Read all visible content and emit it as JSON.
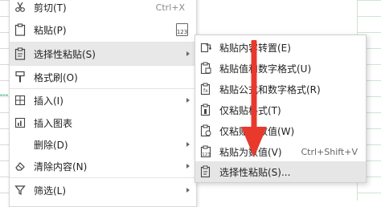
{
  "menu": {
    "items": [
      {
        "label": "剪切(T)",
        "shortcut": "Ctrl+X",
        "icon": "scissors-icon"
      },
      {
        "label": "粘贴(P)",
        "icon": "paste-icon",
        "extra": "123"
      },
      {
        "label": "选择性粘贴(S)",
        "icon": "paste-special-icon"
      },
      {
        "label": "格式刷(O)",
        "icon": "format-brush-icon"
      },
      {
        "label": "插入(I)",
        "icon": "insert-icon"
      },
      {
        "label": "插入图表",
        "icon": "insert-chart-icon"
      },
      {
        "label": "删除(D)",
        "icon": ""
      },
      {
        "label": "清除内容(N)",
        "icon": "eraser-icon"
      },
      {
        "label": "筛选(L)",
        "icon": "filter-icon"
      }
    ]
  },
  "submenu": {
    "items": [
      {
        "label": "粘贴内容转置(E)",
        "icon": "transpose-icon"
      },
      {
        "label": "粘贴值和数字格式(U)",
        "icon": "paste-values-format-icon"
      },
      {
        "label": "粘贴公式和数字格式(R)",
        "icon": "paste-formula-format-icon"
      },
      {
        "label": "仅粘贴格式(T)",
        "icon": "paste-format-brush-icon"
      },
      {
        "label": "仅粘贴为数值(W)",
        "icon": "paste-values-icon"
      },
      {
        "label": "粘贴为数值(V)",
        "shortcut": "Ctrl+Shift+V",
        "icon": "paste-number-icon"
      },
      {
        "label": "选择性粘贴(S)...",
        "icon": "paste-special-dialog-icon"
      }
    ]
  },
  "colors": {
    "highlight": "#e8e8e8",
    "arrow": "#e8392c",
    "accent": "#1f7a45"
  }
}
